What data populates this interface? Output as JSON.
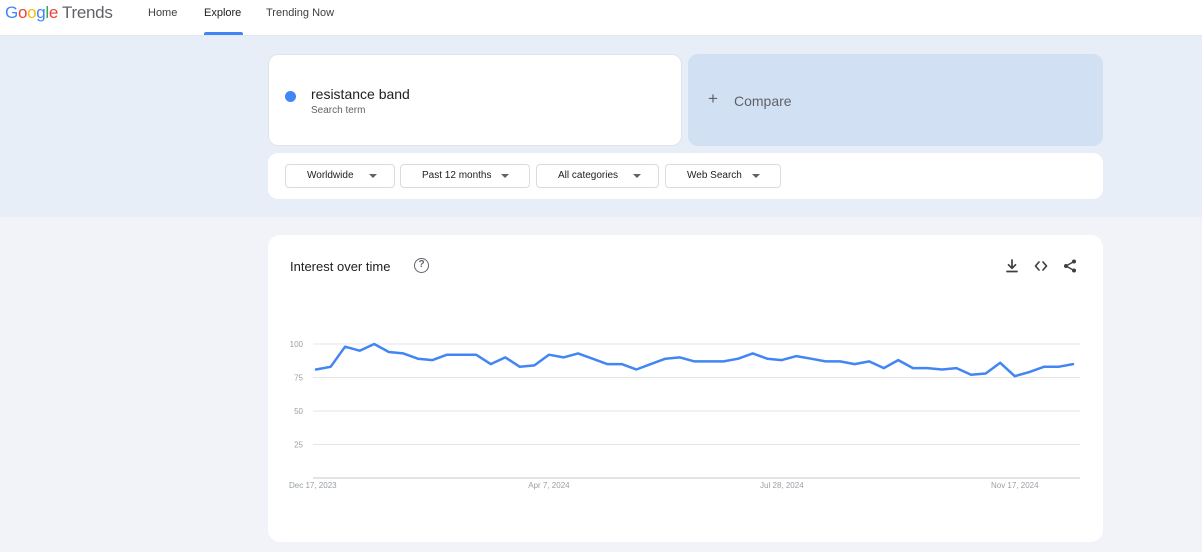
{
  "header": {
    "logo_google": [
      "G",
      "o",
      "o",
      "g",
      "l",
      "e"
    ],
    "logo_trends": "Trends",
    "nav": [
      "Home",
      "Explore",
      "Trending Now"
    ],
    "active_nav": "Explore"
  },
  "search": {
    "term": "resistance band",
    "term_type": "Search term",
    "term_color": "#4285f4",
    "compare_label": "Compare"
  },
  "filters": {
    "region": "Worldwide",
    "time_range": "Past 12 months",
    "category": "All categories",
    "search_type": "Web Search"
  },
  "chart_card": {
    "title": "Interest over time",
    "actions": [
      "download-icon",
      "embed-code-icon",
      "share-icon"
    ]
  },
  "chart_data": {
    "type": "line",
    "title": "Interest over time",
    "series": [
      {
        "color": "#4285f4",
        "values": [
          81,
          83,
          98,
          95,
          100,
          94,
          93,
          89,
          88,
          92,
          92,
          92,
          85,
          90,
          83,
          84,
          92,
          90,
          93,
          89,
          85,
          85,
          81,
          85,
          89,
          90,
          87,
          87,
          87,
          89,
          93,
          89,
          88,
          91,
          89,
          87,
          87,
          85,
          87,
          82,
          88,
          82,
          82,
          81,
          82,
          77,
          78,
          86,
          76,
          79,
          83,
          83,
          85
        ]
      }
    ],
    "x_tick_labels": [
      "Dec 17, 2023",
      "Apr 7, 2024",
      "Jul 28, 2024",
      "Nov 17, 2024"
    ],
    "x_tick_index": [
      0,
      16,
      32,
      48
    ],
    "y_ticks": [
      25,
      50,
      75,
      100
    ],
    "ylim": [
      0,
      100
    ],
    "grid": true
  }
}
